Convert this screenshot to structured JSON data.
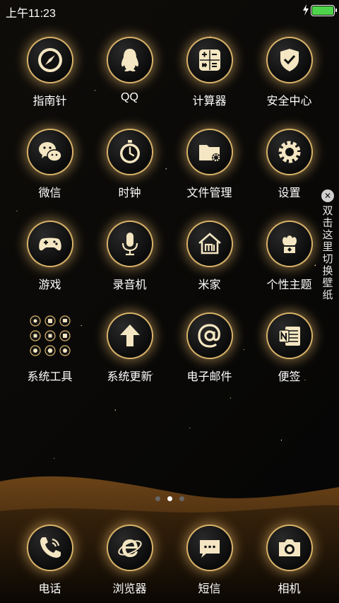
{
  "status_bar": {
    "time": "上午11:23",
    "battery_level": 1.0,
    "charging": true,
    "colors": {
      "battery": "#4ed34a"
    }
  },
  "theme": {
    "accent": "#d8b36a",
    "glow": "#ffcd78",
    "icon_fill": "#f4e6c2"
  },
  "home_apps": [
    {
      "label": "指南针",
      "icon": "compass-icon"
    },
    {
      "label": "QQ",
      "icon": "penguin-icon"
    },
    {
      "label": "计算器",
      "icon": "calculator-icon"
    },
    {
      "label": "安全中心",
      "icon": "shield-check-icon"
    },
    {
      "label": "微信",
      "icon": "chat-bubbles-icon"
    },
    {
      "label": "时钟",
      "icon": "stopwatch-icon"
    },
    {
      "label": "文件管理",
      "icon": "folder-gear-icon"
    },
    {
      "label": "设置",
      "icon": "gear-icon"
    },
    {
      "label": "游戏",
      "icon": "gamepad-icon"
    },
    {
      "label": "录音机",
      "icon": "microphone-icon"
    },
    {
      "label": "米家",
      "icon": "mi-home-icon"
    },
    {
      "label": "个性主题",
      "icon": "theme-crown-icon"
    },
    {
      "label": "系统工具",
      "icon": "tools-folder-icon"
    },
    {
      "label": "系统更新",
      "icon": "arrow-up-icon"
    },
    {
      "label": "电子邮件",
      "icon": "at-sign-icon"
    },
    {
      "label": "便签",
      "icon": "notes-icon"
    }
  ],
  "side_hint": {
    "text": "双击这里切换壁纸",
    "close_icon": "close-icon"
  },
  "pager": {
    "pages": 3,
    "current": 2
  },
  "dock": [
    {
      "label": "电话",
      "icon": "phone-icon"
    },
    {
      "label": "浏览器",
      "icon": "browser-e-icon"
    },
    {
      "label": "短信",
      "icon": "message-icon"
    },
    {
      "label": "相机",
      "icon": "camera-icon"
    }
  ]
}
